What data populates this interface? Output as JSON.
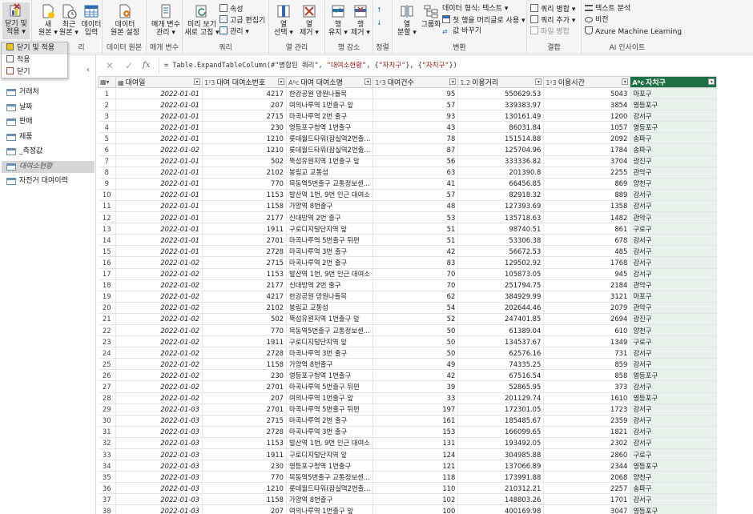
{
  "ribbon": {
    "groups": [
      {
        "label": "",
        "buttons": [
          "닫기 및\n적용 ▾"
        ]
      },
      {
        "label": "리",
        "buttons": [
          "새\n원본 ▾",
          "최근\n원본 ▾",
          "데이터\n입력"
        ]
      },
      {
        "label": "데이터 원본",
        "buttons": [
          "데이터\n원본 설정"
        ]
      },
      {
        "label": "매개 변수",
        "buttons": [
          "매개 변수\n관리 ▾"
        ]
      },
      {
        "label": "쿼리",
        "buttons": [
          "미리 보기\n새로 고침 ▾"
        ],
        "small": [
          "속성",
          "고급 편집기",
          "관리 ▾"
        ]
      },
      {
        "label": "열 관리",
        "buttons": [
          "열\n선택 ▾",
          "열\n제거 ▾"
        ]
      },
      {
        "label": "행 감소",
        "buttons": [
          "행\n유지 ▾",
          "행\n제거 ▾"
        ]
      },
      {
        "label": "정렬",
        "buttons": []
      },
      {
        "label": "변환",
        "buttons": [
          "열\n분할 ▾",
          "그룹화"
        ],
        "small": [
          "데이터 형식: 텍스트 ▾",
          "첫 행을 머리글로 사용 ▾",
          "값 바꾸기"
        ]
      },
      {
        "label": "결합",
        "small": [
          "쿼리 병합 ▾",
          "쿼리 추가 ▾",
          "파일 병합"
        ]
      },
      {
        "label": "AI 인사이트",
        "small": [
          "텍스트 분석",
          "비전",
          "Azure Machine Learning"
        ]
      }
    ]
  },
  "menu": {
    "items": [
      "닫기 및 적용",
      "적용",
      "닫기"
    ]
  },
  "sidebar": {
    "items": [
      "거래처",
      "날짜",
      "판매",
      "제품",
      "_측정값",
      "대여소현황",
      "자전거 대여이력"
    ],
    "selected_index": 5
  },
  "formula": {
    "prefix": "= Table.ExpandTableColumn(#\"병합된 쿼리\", ",
    "s1": "\"대여소현황\"",
    "mid1": ", {",
    "s2": "\"자치구\"",
    "mid2": "}, {",
    "s3": "\"자치구\"",
    "suffix": "})"
  },
  "columns": [
    {
      "type": "▦",
      "name": "대여일"
    },
    {
      "type": "1²3",
      "name": "대여 대여소번호"
    },
    {
      "type": "Aᴮc",
      "name": "대여 대여소명"
    },
    {
      "type": "1²3",
      "name": "대여건수"
    },
    {
      "type": "1.2",
      "name": "이용거리"
    },
    {
      "type": "1²3",
      "name": "이용시간"
    },
    {
      "type": "Aᴮc",
      "name": "자치구"
    }
  ],
  "rows": [
    [
      "2022-01-01",
      "4217",
      "한강공원 망원나들목",
      "95",
      "550629.53",
      "5043",
      "마포구"
    ],
    [
      "2022-01-01",
      "207",
      "여의나루역 1번출구 앞",
      "57",
      "339383.97",
      "3854",
      "영등포구"
    ],
    [
      "2022-01-01",
      "2715",
      "마곡나루역 2번 출구",
      "93",
      "130161.49",
      "1200",
      "강서구"
    ],
    [
      "2022-01-01",
      "230",
      "영등포구청역 1번출구",
      "43",
      "86031.84",
      "1057",
      "영등포구"
    ],
    [
      "2022-01-01",
      "1210",
      "롯데월드타워(잠실역2번출...",
      "78",
      "151514.88",
      "2092",
      "송파구"
    ],
    [
      "2022-01-02",
      "1210",
      "롯데월드타워(잠실역2번출...",
      "87",
      "125704.96",
      "1784",
      "송파구"
    ],
    [
      "2022-01-01",
      "502",
      "뚝섬유원지역 1번출구 앞",
      "56",
      "333336.82",
      "3704",
      "광진구"
    ],
    [
      "2022-01-01",
      "2102",
      "봉림교 교통섬",
      "63",
      "201390.8",
      "2255",
      "관악구"
    ],
    [
      "2022-01-01",
      "770",
      "목동역5번출구 교통정보센...",
      "41",
      "66456.85",
      "869",
      "양천구"
    ],
    [
      "2022-01-01",
      "1153",
      "발산역 1번, 9번 인근 대여소",
      "57",
      "82918.32",
      "889",
      "강서구"
    ],
    [
      "2022-01-01",
      "1158",
      "가양역 8번출구",
      "48",
      "127393.69",
      "1358",
      "강서구"
    ],
    [
      "2022-01-01",
      "2177",
      "신대방역 2번 출구",
      "53",
      "135718.63",
      "1482",
      "관악구"
    ],
    [
      "2022-01-01",
      "1911",
      "구로디지털단지역 앞",
      "51",
      "98740.51",
      "861",
      "구로구"
    ],
    [
      "2022-01-01",
      "2701",
      "마곡나루역 5번출구 뒤편",
      "51",
      "53306.38",
      "678",
      "강서구"
    ],
    [
      "2022-01-01",
      "2728",
      "마곡나루역 3번 출구",
      "42",
      "56672.53",
      "485",
      "강서구"
    ],
    [
      "2022-01-02",
      "2715",
      "마곡나루역 2번 출구",
      "83",
      "129502.92",
      "1768",
      "강서구"
    ],
    [
      "2022-01-02",
      "1153",
      "발산역 1번, 9번 인근 대여소",
      "70",
      "105873.05",
      "945",
      "강서구"
    ],
    [
      "2022-01-02",
      "2177",
      "신대방역 2번 출구",
      "70",
      "251794.75",
      "2184",
      "관악구"
    ],
    [
      "2022-01-02",
      "4217",
      "한강공원 망원나들목",
      "62",
      "384929.99",
      "3121",
      "마포구"
    ],
    [
      "2022-01-02",
      "2102",
      "봉림교 교통섬",
      "54",
      "202644.46",
      "2079",
      "관악구"
    ],
    [
      "2022-01-02",
      "502",
      "뚝섬유원지역 1번출구 앞",
      "52",
      "247401.85",
      "2694",
      "광진구"
    ],
    [
      "2022-01-02",
      "770",
      "목동역5번출구 교통정보센...",
      "50",
      "61389.04",
      "610",
      "양천구"
    ],
    [
      "2022-01-02",
      "1911",
      "구로디지털단지역 앞",
      "50",
      "134537.67",
      "1349",
      "구로구"
    ],
    [
      "2022-01-02",
      "2728",
      "마곡나루역 3번 출구",
      "50",
      "62576.16",
      "731",
      "강서구"
    ],
    [
      "2022-01-02",
      "1158",
      "가양역 8번출구",
      "49",
      "74335.25",
      "859",
      "강서구"
    ],
    [
      "2022-01-02",
      "230",
      "영등포구청역 1번출구",
      "42",
      "67516.54",
      "858",
      "영등포구"
    ],
    [
      "2022-01-02",
      "2701",
      "마곡나루역 5번출구 뒤편",
      "39",
      "52865.95",
      "373",
      "강서구"
    ],
    [
      "2022-01-02",
      "207",
      "여의나루역 1번출구 앞",
      "33",
      "201129.74",
      "1610",
      "영등포구"
    ],
    [
      "2022-01-03",
      "2701",
      "마곡나루역 5번출구 뒤편",
      "197",
      "172301.05",
      "1723",
      "강서구"
    ],
    [
      "2022-01-03",
      "2715",
      "마곡나루역 2번 출구",
      "161",
      "185485.67",
      "2359",
      "강서구"
    ],
    [
      "2022-01-03",
      "2728",
      "마곡나루역 3번 출구",
      "153",
      "166099.65",
      "1821",
      "강서구"
    ],
    [
      "2022-01-03",
      "1153",
      "발산역 1번, 9번 인근 대여소",
      "131",
      "193492.05",
      "2302",
      "강서구"
    ],
    [
      "2022-01-03",
      "1911",
      "구로디지털단지역 앞",
      "124",
      "304985.88",
      "2860",
      "구로구"
    ],
    [
      "2022-01-03",
      "230",
      "영등포구청역 1번출구",
      "121",
      "137066.89",
      "2344",
      "영등포구"
    ],
    [
      "2022-01-03",
      "770",
      "목동역5번출구 교통정보센...",
      "118",
      "173991.88",
      "2068",
      "양천구"
    ],
    [
      "2022-01-03",
      "1210",
      "롯데월드타워(잠실역2번출...",
      "110",
      "210312.21",
      "2257",
      "송파구"
    ],
    [
      "2022-01-03",
      "1158",
      "가양역 8번출구",
      "102",
      "148803.26",
      "1701",
      "강서구"
    ],
    [
      "2022-01-03",
      "207",
      "여의나루역 1번출구 앞",
      "100",
      "400169.98",
      "3047",
      "영등포구"
    ]
  ]
}
